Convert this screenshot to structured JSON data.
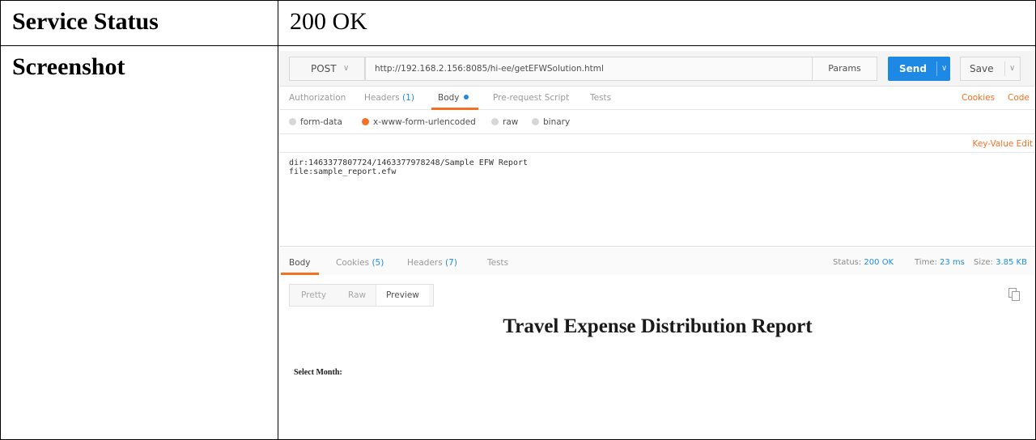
{
  "table": {
    "row1": {
      "label": "Service Status",
      "value": "200 OK"
    },
    "row2": {
      "label": "Screenshot"
    }
  },
  "request": {
    "method": "POST",
    "url": "http://192.168.2.156:8085/hi-ee/getEFWSolution.html",
    "params_label": "Params",
    "send_label": "Send",
    "save_label": "Save"
  },
  "request_tabs": {
    "authorization": "Authorization",
    "headers": "Headers",
    "headers_count": "(1)",
    "body": "Body",
    "prerequest": "Pre-request Script",
    "tests": "Tests",
    "cookies_link": "Cookies",
    "code_link": "Code"
  },
  "body_modes": {
    "form_data": "form-data",
    "urlencoded": "x-www-form-urlencoded",
    "raw": "raw",
    "binary": "binary",
    "selected": "x-www-form-urlencoded"
  },
  "key_value_edit": "Key-Value Edit",
  "raw_body": {
    "line1": "dir:1463377807724/1463377978248/Sample EFW Report",
    "line2": "file:sample_report.efw"
  },
  "response_tabs": {
    "body": "Body",
    "cookies": "Cookies",
    "cookies_count": "(5)",
    "headers": "Headers",
    "headers_count": "(7)",
    "tests": "Tests"
  },
  "response_status": {
    "status_label": "Status:",
    "status_value": "200 OK",
    "time_label": "Time:",
    "time_value": "23 ms",
    "size_label": "Size:",
    "size_value": "3.85 KB"
  },
  "view_modes": {
    "pretty": "Pretty",
    "raw": "Raw",
    "preview": "Preview",
    "selected": "Preview"
  },
  "preview": {
    "title": "Travel Expense Distribution Report",
    "select_month": "Select Month:"
  },
  "colors": {
    "accent_orange": "#f47023",
    "send_blue": "#1e88e5",
    "link_blue": "#1f8de0"
  },
  "icons": [
    "chevron-down-icon",
    "copy-icon"
  ]
}
